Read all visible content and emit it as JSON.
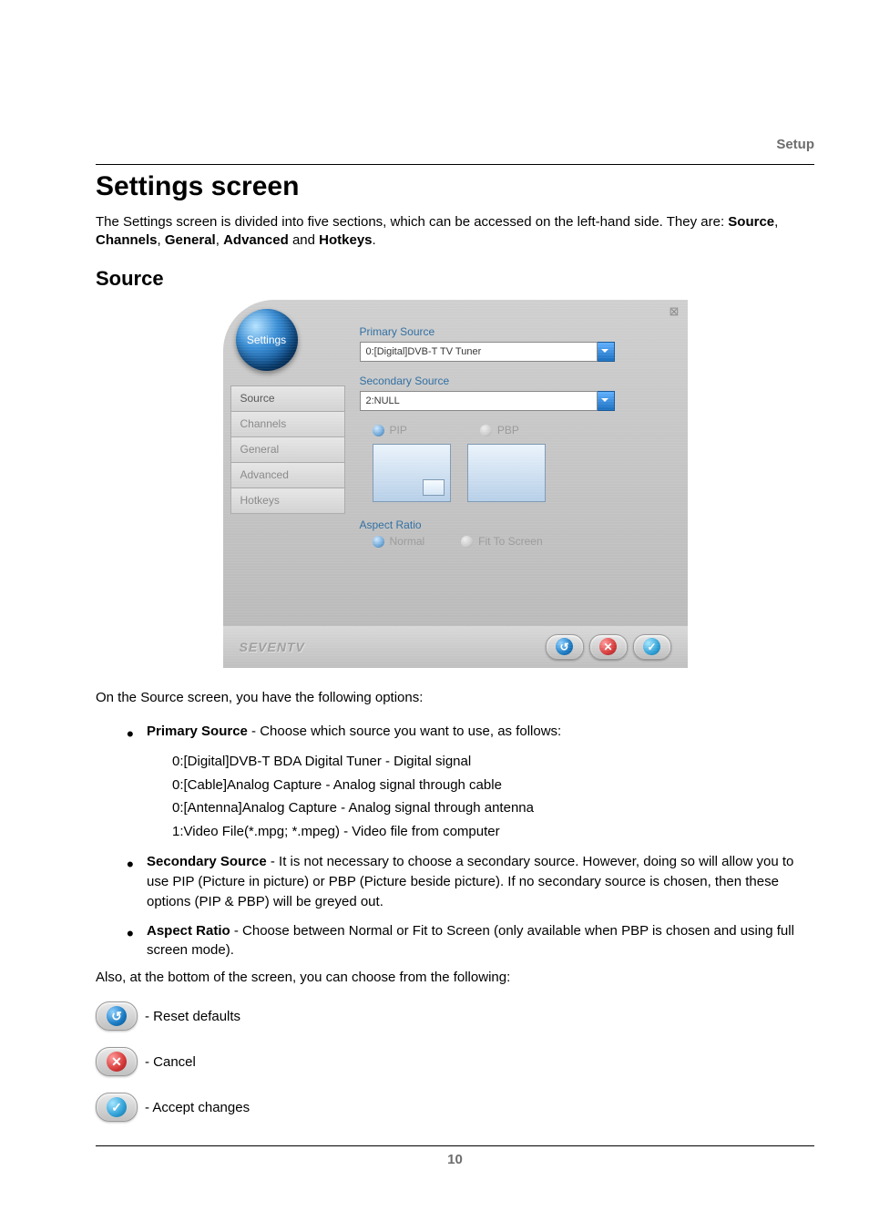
{
  "header": {
    "section": "Setup"
  },
  "title": "Settings screen",
  "intro_a": "The Settings screen is divided into five sections, which can be accessed on the left-hand side. They are: ",
  "intro_b_sections": [
    "Source",
    "Channels",
    "General",
    "Advanced",
    "Hotkeys"
  ],
  "intro_and": " and ",
  "intro_period": ".",
  "subheading": "Source",
  "dialog": {
    "orb_label": "Settings",
    "tabs": [
      "Source",
      "Channels",
      "General",
      "Advanced",
      "Hotkeys"
    ],
    "primary_label": "Primary Source",
    "primary_value": "0:[Digital]DVB-T TV Tuner",
    "secondary_label": "Secondary Source",
    "secondary_value": "2:NULL",
    "radio_pip": "PIP",
    "radio_pbp": "PBP",
    "aspect_label": "Aspect Ratio",
    "aspect_normal": "Normal",
    "aspect_fit": "Fit To Screen",
    "logo": "SEVENTV",
    "reset_glyph": "↺",
    "cancel_glyph": "✕",
    "accept_glyph": "✓"
  },
  "after_shot": "On the Source screen, you have the following options:",
  "bullets": {
    "primary_lead": "Primary Source",
    "primary_rest": " - Choose which source you want to use, as follows:",
    "primary_lines": [
      "0:[Digital]DVB-T BDA Digital Tuner - Digital signal",
      "0:[Cable]Analog Capture - Analog signal through cable",
      "0:[Antenna]Analog Capture - Analog signal through antenna",
      "1:Video File(*.mpg; *.mpeg) - Video file from computer"
    ],
    "secondary_lead": "Secondary Source",
    "secondary_rest": " - It is not necessary to choose a secondary source. However, doing so will allow you to use PIP (Picture in picture) or PBP (Picture beside picture). If no secondary source is chosen, then these options (PIP & PBP) will be greyed out.",
    "aspect_lead": "Aspect Ratio",
    "aspect_rest": " - Choose between Normal or Fit to Screen (only available when PBP is chosen and using full screen mode)."
  },
  "also_line": "Also, at the bottom of the screen, you can choose from the following:",
  "icon_lines": {
    "reset": " - Reset defaults",
    "cancel": " - Cancel",
    "accept": " - Accept changes"
  },
  "page_number": "10"
}
